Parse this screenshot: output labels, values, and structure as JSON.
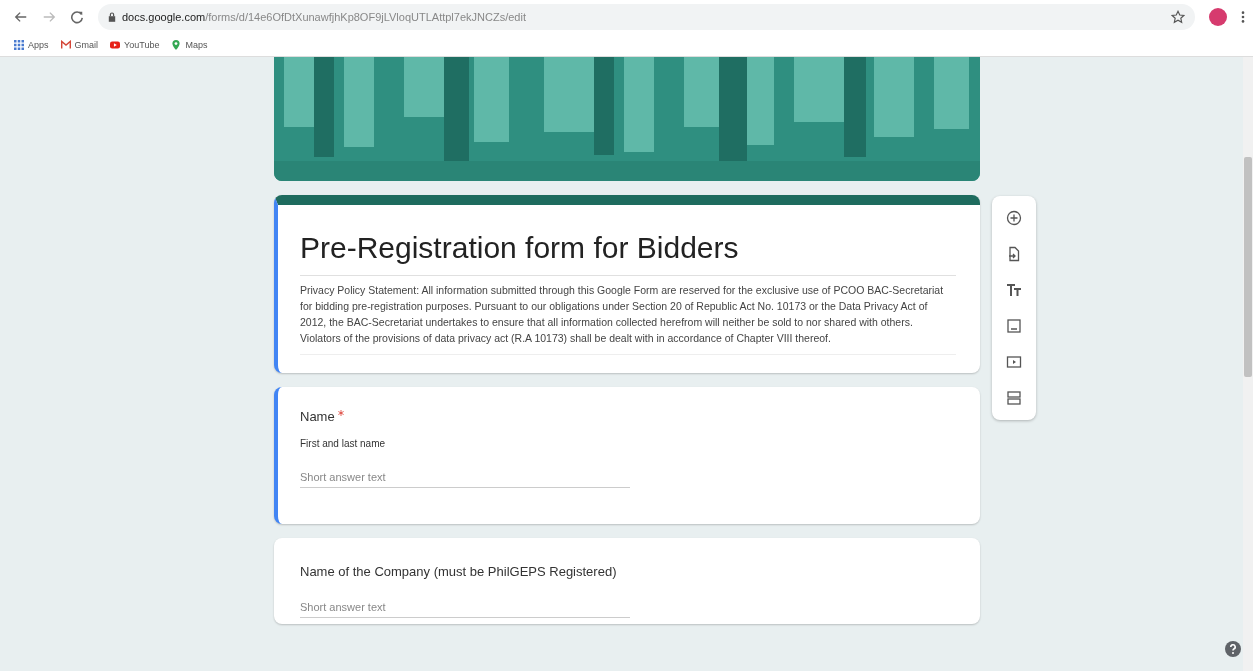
{
  "browser": {
    "address": {
      "host": "docs.google.com",
      "path": "/forms/d/14e6OfDtXunawfjhKp8OF9jLVloqUTLAttpl7ekJNCZs/edit"
    },
    "bookmarks": [
      {
        "label": "Apps",
        "kind": "apps"
      },
      {
        "label": "Gmail",
        "kind": "gmail"
      },
      {
        "label": "YouTube",
        "kind": "youtube"
      },
      {
        "label": "Maps",
        "kind": "maps"
      }
    ]
  },
  "form": {
    "title": "Pre-Registration form for Bidders",
    "selected": true,
    "description": "Privacy Policy Statement: All information submitted through this Google Form are reserved for the exclusive use of PCOO BAC-Secretariat for bidding pre-registration purposes. Pursuant to our obligations under Section 20 of Republic Act No. 10173 or the Data Privacy Act of 2012, the BAC-Secretariat undertakes to ensure that all information collected herefrom will neither be sold to nor shared with others. Violators of the provisions of data privacy act  (R.A 10173) shall be dealt with in accordance of Chapter VIII thereof."
  },
  "questions": [
    {
      "title": "Name",
      "required": true,
      "description": "First and last name",
      "placeholder": "Short answer text",
      "selected": true
    },
    {
      "title": "Name of the Company (must be PhilGEPS Registered)",
      "required": false,
      "placeholder": "Short answer text",
      "selected": false
    }
  ]
}
